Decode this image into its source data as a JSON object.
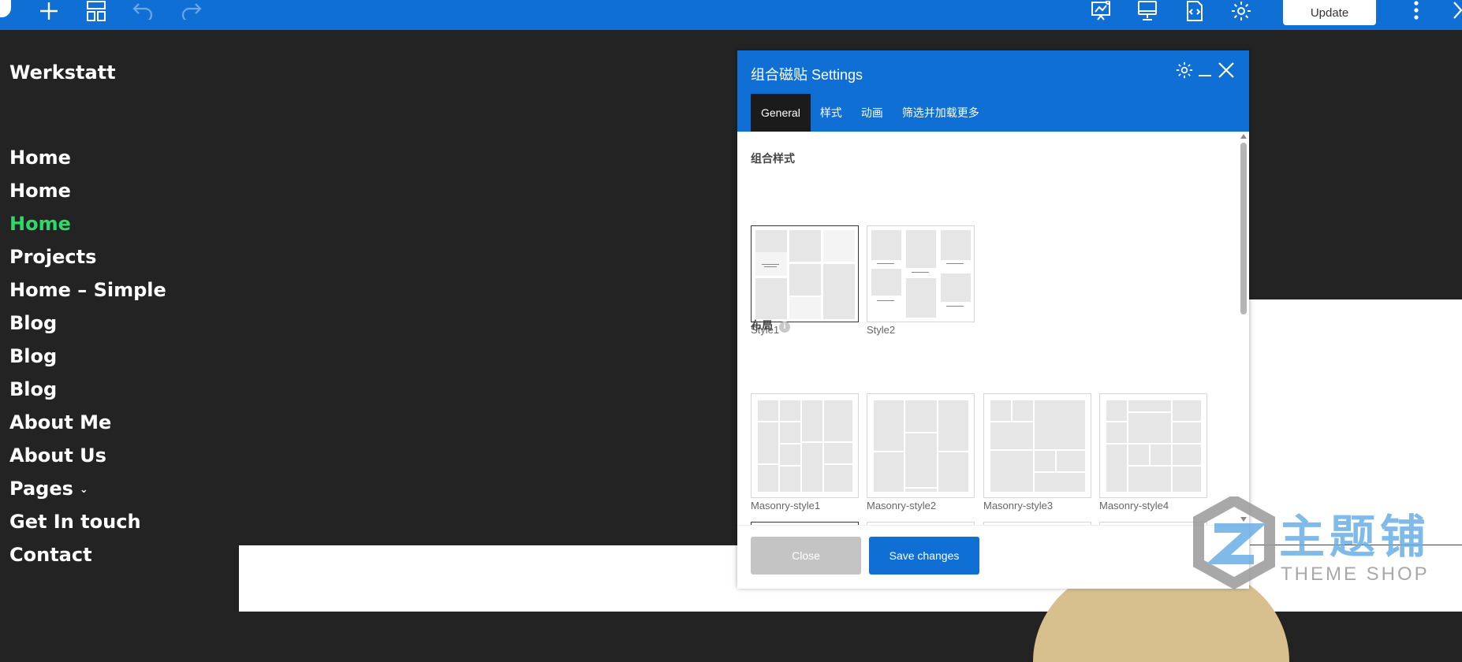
{
  "toolbar": {
    "icons": [
      "add-icon",
      "layout-icon",
      "undo-icon",
      "redo-icon",
      "analytics-icon",
      "desktop-preview-icon",
      "code-icon",
      "gear-icon",
      "more-vertical-icon",
      "chevron-right-icon"
    ],
    "update_label": "Update",
    "bg_color": "#0f6fd4"
  },
  "site": {
    "title": "Werkstatt"
  },
  "menu": {
    "items": [
      {
        "label": "Home"
      },
      {
        "label": "Home"
      },
      {
        "label": "Home",
        "active": true
      },
      {
        "label": "Projects"
      },
      {
        "label": "Home – Simple"
      },
      {
        "label": "Blog"
      },
      {
        "label": "Blog"
      },
      {
        "label": "Blog"
      },
      {
        "label": "About Me"
      },
      {
        "label": "About Us"
      },
      {
        "label": "Pages",
        "has_submenu": true
      },
      {
        "label": "Get In touch"
      },
      {
        "label": "Contact"
      }
    ],
    "active_color": "#2fd86b",
    "submenu_glyph": "⌄"
  },
  "modal": {
    "title": "组合磁贴 Settings",
    "tabs": [
      {
        "label": "General",
        "active": true
      },
      {
        "label": "样式"
      },
      {
        "label": "动画"
      },
      {
        "label": "筛选并加载更多"
      }
    ],
    "section_style": {
      "label": "组合样式",
      "options": [
        {
          "label": "Style1",
          "selected": true
        },
        {
          "label": "Style2"
        }
      ]
    },
    "section_layout": {
      "label": "布局",
      "info_glyph": "i",
      "options": [
        {
          "label": "Masonry-style1",
          "selected": true
        },
        {
          "label": "Masonry-style2"
        },
        {
          "label": "Masonry-style3"
        },
        {
          "label": "Masonry-style4"
        }
      ]
    },
    "close_label": "Close",
    "save_label": "Save changes"
  },
  "watermark": {
    "cn": "主题铺",
    "en": "THEME SHOP"
  }
}
